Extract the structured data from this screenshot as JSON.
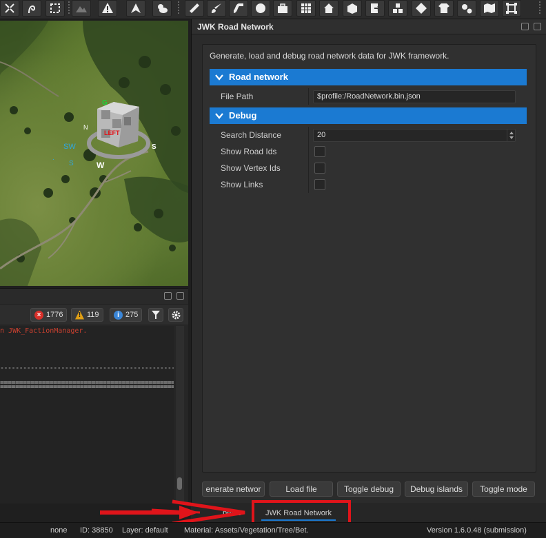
{
  "toolbar": {
    "tools": [
      {
        "icon": "snap-icon"
      },
      {
        "icon": "curve-icon"
      },
      {
        "icon": "selection-icon"
      },
      {
        "icon": "terrain-icon"
      },
      {
        "icon": "hazard-icon"
      },
      {
        "icon": "triangle-icon"
      },
      {
        "icon": "weather-icon"
      },
      {
        "icon": "ruler-icon"
      },
      {
        "icon": "brush-icon"
      },
      {
        "icon": "road-icon"
      },
      {
        "icon": "sphere-icon"
      },
      {
        "icon": "toolbox-icon"
      },
      {
        "icon": "grid-icon"
      },
      {
        "icon": "house-tool-icon"
      },
      {
        "icon": "box-icon"
      },
      {
        "icon": "export-icon"
      },
      {
        "icon": "boxes-icon"
      },
      {
        "icon": "diamond-icon"
      },
      {
        "icon": "shirt-icon"
      },
      {
        "icon": "gears-icon"
      },
      {
        "icon": "map-icon"
      },
      {
        "icon": "frame-icon"
      }
    ]
  },
  "viewport": {
    "gizmo_faces": [
      "LEFT"
    ],
    "compass": {
      "n": "N",
      "s": "S",
      "w": "W"
    }
  },
  "console": {
    "counts": {
      "errors": "1776",
      "warnings": "119",
      "infos": "275"
    },
    "lines": [
      "in JWK_FactionManager.",
      "-----------------------------------------------------",
      "=====================================================",
      "====================================================="
    ]
  },
  "panel": {
    "title": "JWK Road Network",
    "description": "Generate, load and debug road network data for JWK framework.",
    "sections": {
      "road_network": {
        "label": "Road network",
        "file_path_label": "File Path",
        "file_path_value": "$profile:/RoadNetwork.bin.json"
      },
      "debug": {
        "label": "Debug",
        "search_distance_label": "Search Distance",
        "search_distance_value": "20",
        "show_road_ids_label": "Show Road Ids",
        "show_vertex_ids_label": "Show Vertex Ids",
        "show_links_label": "Show Links"
      }
    },
    "buttons": {
      "generate": "enerate networ",
      "load": "Load file",
      "toggle_debug": "Toggle debug",
      "debug_islands": "Debug islands",
      "toggle_mode": "Toggle mode"
    }
  },
  "tabs": {
    "properties": "pertie",
    "road_network": "JWK Road Network"
  },
  "status": {
    "selection": "none",
    "id": "ID: 38850",
    "layer": "Layer: default",
    "material": "Material: Assets/Vegetation/Tree/Bet.",
    "version": "Version 1.6.0.48 (submission)"
  },
  "colors": {
    "accent": "#1b7ad2",
    "highlight": "#e0141a",
    "error": "#d9302a",
    "warning": "#e2a014",
    "info": "#3a86d8"
  }
}
